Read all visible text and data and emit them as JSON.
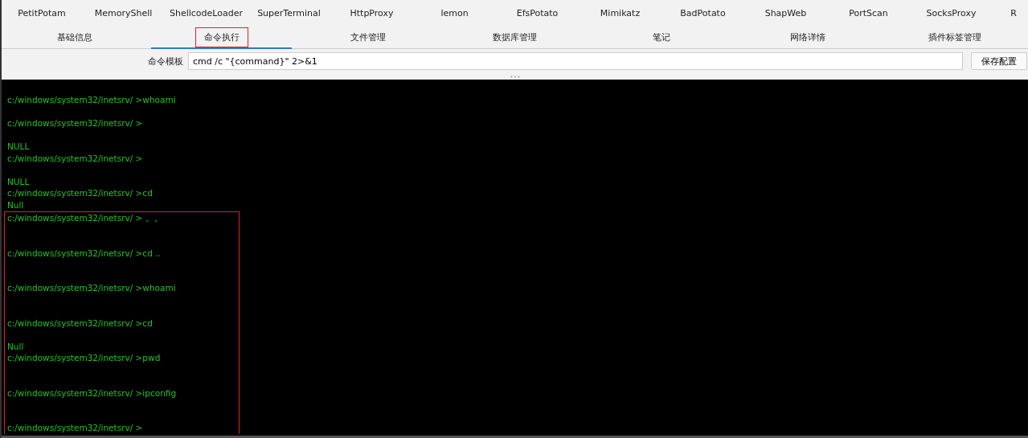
{
  "plugin_tabs": [
    {
      "label": "PetitPotam"
    },
    {
      "label": "MemoryShell"
    },
    {
      "label": "ShellcodeLoader"
    },
    {
      "label": "SuperTerminal"
    },
    {
      "label": "HttpProxy"
    },
    {
      "label": "lemon"
    },
    {
      "label": "EfsPotato"
    },
    {
      "label": "Mimikatz"
    },
    {
      "label": "BadPotato"
    },
    {
      "label": "ShapWeb"
    },
    {
      "label": "PortScan"
    },
    {
      "label": "SocksProxy"
    },
    {
      "label": "R"
    }
  ],
  "tabs": [
    {
      "label": "基础信息",
      "selected": false,
      "highlighted": false
    },
    {
      "label": "命令执行",
      "selected": true,
      "highlighted": true
    },
    {
      "label": "文件管理",
      "selected": false,
      "highlighted": false
    },
    {
      "label": "数据库管理",
      "selected": false,
      "highlighted": false
    },
    {
      "label": "笔记",
      "selected": false,
      "highlighted": false
    },
    {
      "label": "网络详情",
      "selected": false,
      "highlighted": false
    },
    {
      "label": "插件标签管理",
      "selected": false,
      "highlighted": false
    }
  ],
  "template": {
    "label": "命令模板",
    "value": "cmd /c \"{command}\" 2>&1",
    "button": "保存配置"
  },
  "terminal": {
    "blocks": [
      {
        "text": "c:/windows/system32/inetsrv/ >whoami\n\nc:/windows/system32/inetsrv/ >\n\nNULL\nc:/windows/system32/inetsrv/ >\n\nNULL\nc:/windows/system32/inetsrv/ >cd\nNull",
        "highlighted": false
      },
      {
        "text": "c:/windows/system32/inetsrv/ > 。。\n\n\nc:/windows/system32/inetsrv/ >cd ..\n\n\nc:/windows/system32/inetsrv/ >whoami\n\n\nc:/windows/system32/inetsrv/ >cd\n\nNull\nc:/windows/system32/inetsrv/ >pwd\n\n\nc:/windows/system32/inetsrv/ >ipconfig\n\n\nc:/windows/system32/inetsrv/ >",
        "highlighted": true
      }
    ]
  }
}
